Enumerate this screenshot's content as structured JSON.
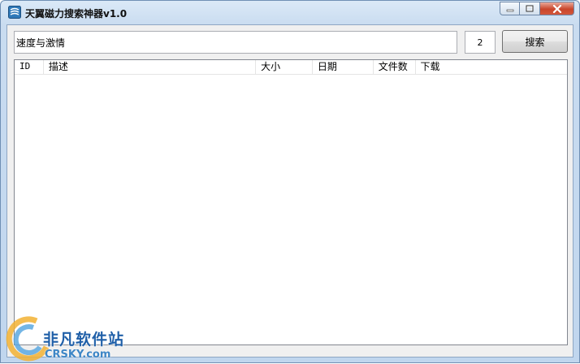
{
  "window": {
    "title": "天翼磁力搜索神器v1.0",
    "icon": "app-logo-icon",
    "controls": [
      "minimize-icon",
      "maximize-icon",
      "close-icon"
    ]
  },
  "search": {
    "query": "速度与激情",
    "count": "2",
    "button_label": "搜索"
  },
  "results": {
    "columns": [
      "ID",
      "描述",
      "大小",
      "日期",
      "文件数",
      "下载"
    ],
    "rows": []
  },
  "watermark": {
    "text": "非凡软件站",
    "site": "CRSKY.com"
  },
  "colors": {
    "accent": "#1f5fa8",
    "close": "#c9462c"
  }
}
